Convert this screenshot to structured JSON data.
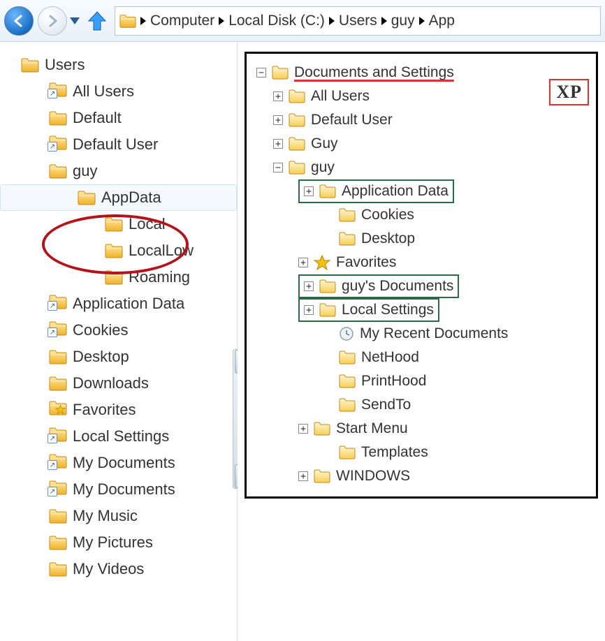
{
  "toolbar": {
    "breadcrumb": [
      "Computer",
      "Local Disk (C:)",
      "Users",
      "guy"
    ],
    "breadcrumb_tail": "App"
  },
  "left_tree": {
    "root": "Users",
    "items": [
      {
        "label": "All Users",
        "icon": "folder-shortcut",
        "indent": 1
      },
      {
        "label": "Default",
        "icon": "folder",
        "indent": 1
      },
      {
        "label": "Default User",
        "icon": "folder-shortcut",
        "indent": 1
      },
      {
        "label": "guy",
        "icon": "folder",
        "indent": 1
      },
      {
        "label": "AppData",
        "icon": "folder",
        "indent": 2,
        "selected": true
      },
      {
        "label": "Local",
        "icon": "folder",
        "indent": 3
      },
      {
        "label": "LocalLow",
        "icon": "folder",
        "indent": 3
      },
      {
        "label": "Roaming",
        "icon": "folder",
        "indent": 3
      },
      {
        "label": "Application Data",
        "icon": "folder-shortcut",
        "indent": 1
      },
      {
        "label": "Cookies",
        "icon": "folder-shortcut",
        "indent": 1
      },
      {
        "label": "Desktop",
        "icon": "folder",
        "indent": 1
      },
      {
        "label": "Downloads",
        "icon": "folder",
        "indent": 1
      },
      {
        "label": "Favorites",
        "icon": "folder-star",
        "indent": 1
      },
      {
        "label": "Local Settings",
        "icon": "folder-shortcut",
        "indent": 1
      },
      {
        "label": "My Documents",
        "icon": "folder-shortcut",
        "indent": 1
      },
      {
        "label": "My Documents",
        "icon": "folder-shortcut",
        "indent": 1
      },
      {
        "label": "My Music",
        "icon": "folder",
        "indent": 1
      },
      {
        "label": "My Pictures",
        "icon": "folder",
        "indent": 1
      },
      {
        "label": "My Videos",
        "icon": "folder",
        "indent": 1
      }
    ]
  },
  "xp": {
    "badge": "XP",
    "root": "Documents and Settings",
    "items": [
      {
        "label": "All Users",
        "exp": "plus",
        "icon": "folder",
        "indent": 1
      },
      {
        "label": "Default User",
        "exp": "plus",
        "icon": "folder",
        "indent": 1
      },
      {
        "label": "Guy",
        "exp": "plus",
        "icon": "folder",
        "indent": 1
      },
      {
        "label": "guy",
        "exp": "minus",
        "icon": "folder",
        "indent": 1
      },
      {
        "label": "Application Data",
        "exp": "plus",
        "icon": "folder",
        "indent": 2,
        "box": true
      },
      {
        "label": "Cookies",
        "icon": "folder",
        "indent": 3
      },
      {
        "label": "Desktop",
        "icon": "folder",
        "indent": 3
      },
      {
        "label": "Favorites",
        "exp": "plus",
        "icon": "star",
        "indent": 2
      },
      {
        "label": "guy's Documents",
        "exp": "plus",
        "icon": "folder",
        "indent": 2,
        "box": true
      },
      {
        "label": "Local Settings",
        "exp": "plus",
        "icon": "folder",
        "indent": 2,
        "box": true
      },
      {
        "label": "My Recent Documents",
        "icon": "clock",
        "indent": 3
      },
      {
        "label": "NetHood",
        "icon": "folder",
        "indent": 3
      },
      {
        "label": "PrintHood",
        "icon": "folder",
        "indent": 3
      },
      {
        "label": "SendTo",
        "icon": "folder",
        "indent": 3
      },
      {
        "label": "Start Menu",
        "exp": "plus",
        "icon": "folder",
        "indent": 2
      },
      {
        "label": "Templates",
        "icon": "folder",
        "indent": 3
      },
      {
        "label": "WINDOWS",
        "exp": "plus",
        "icon": "folder",
        "indent": 2
      }
    ]
  }
}
